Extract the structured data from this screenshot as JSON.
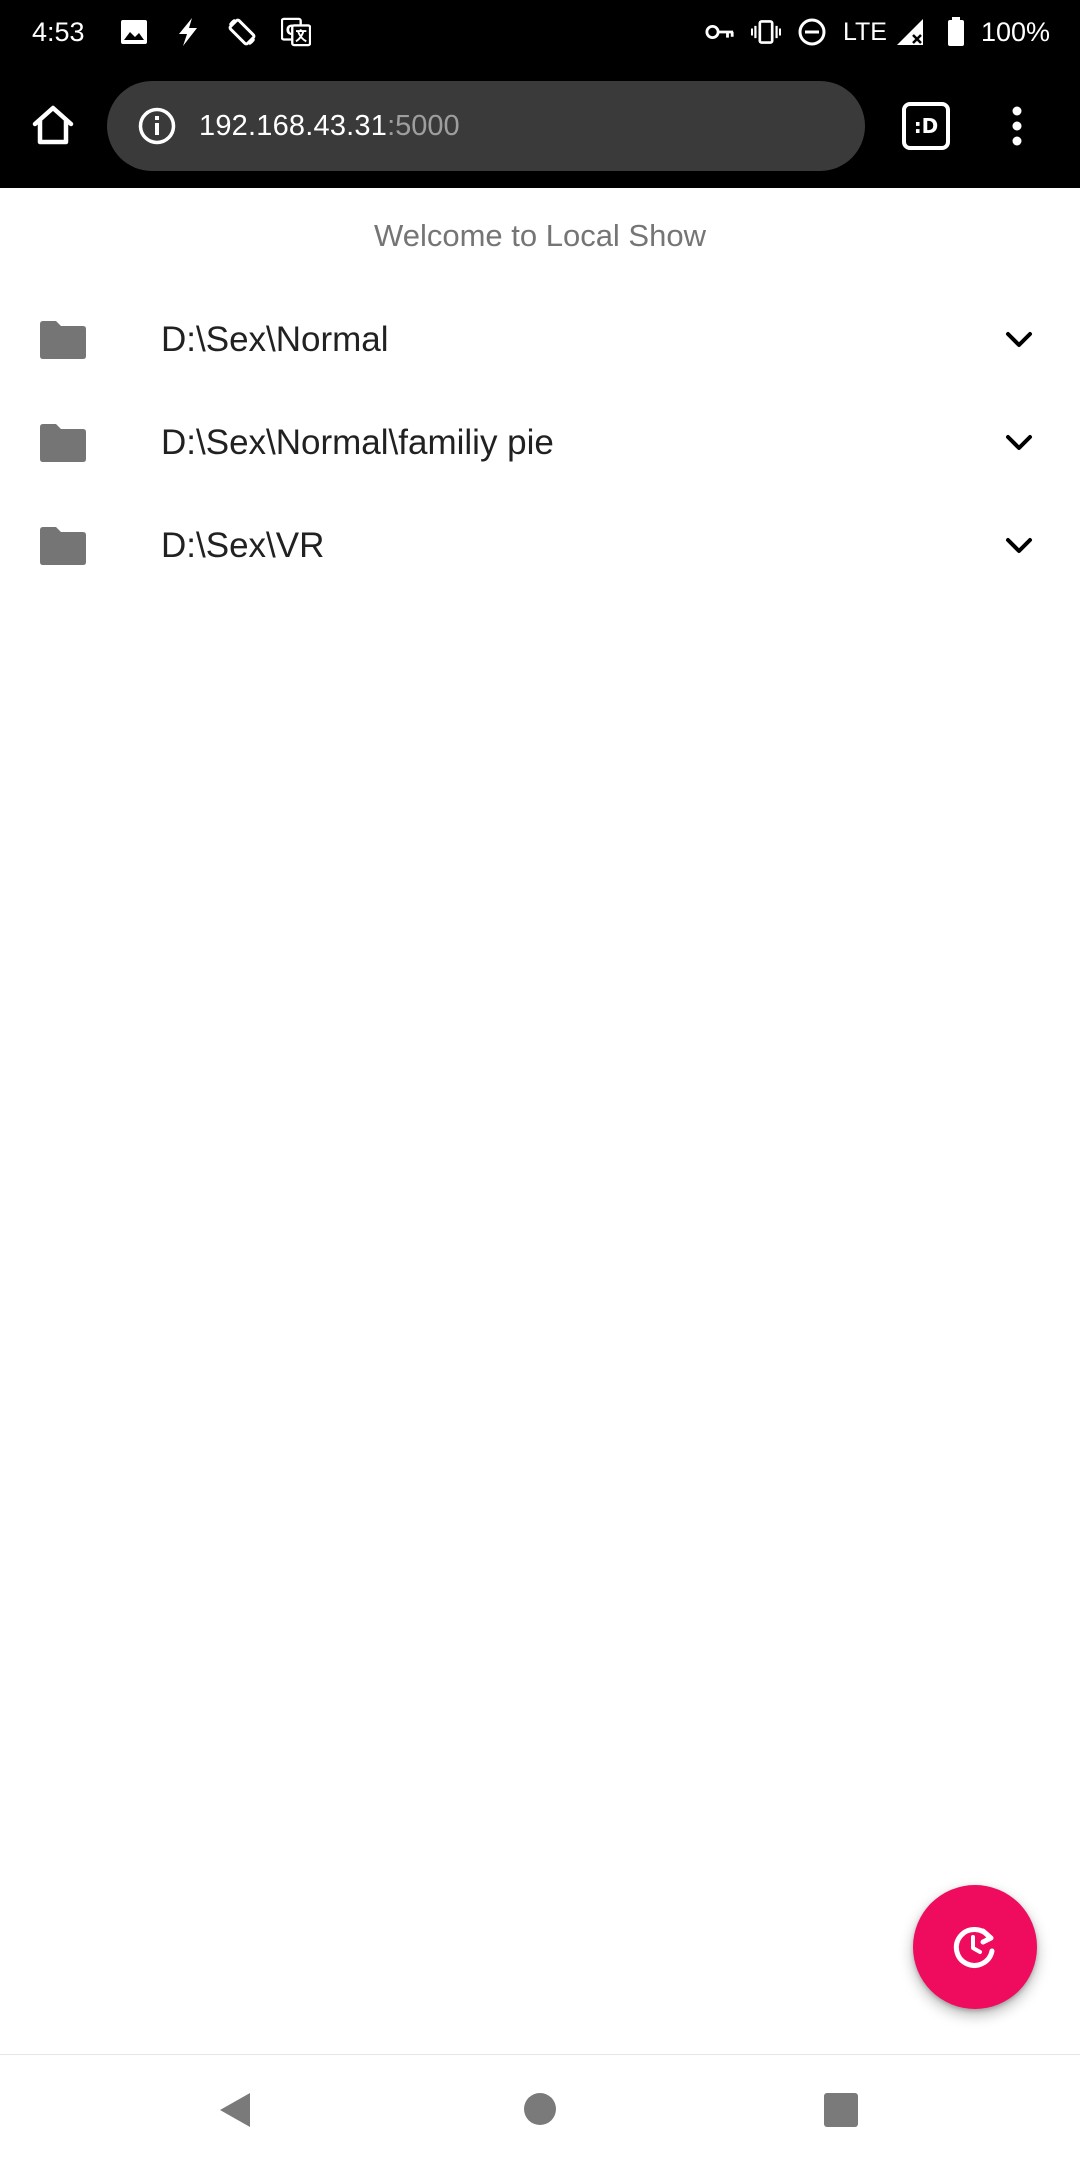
{
  "status_bar": {
    "time": "4:53",
    "network_label": "LTE",
    "battery_percent": "100%",
    "left_icons": [
      "image-icon",
      "flash-icon",
      "screen-rotate-icon",
      "translate-icon"
    ],
    "right_icons": [
      "vpn-key-icon",
      "vibrate-icon",
      "do-not-disturb-icon",
      "signal-icon",
      "battery-icon"
    ]
  },
  "browser": {
    "url_host": "192.168.43.31",
    "url_port": ":5000",
    "tabs_label": ":D"
  },
  "page": {
    "title": "Welcome to Local Show",
    "folders": [
      {
        "path": "D:\\Sex\\Normal"
      },
      {
        "path": "D:\\Sex\\Normal\\familiy pie"
      },
      {
        "path": "D:\\Sex\\VR"
      }
    ]
  },
  "fab": {
    "icon": "history-refresh-icon",
    "color": "#ef0b5e"
  },
  "nav_bar": {
    "icons": [
      "back-icon",
      "home-icon",
      "recents-icon"
    ]
  }
}
